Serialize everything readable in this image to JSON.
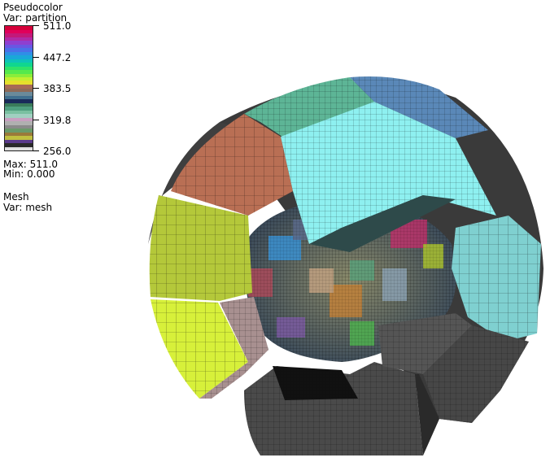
{
  "legend": {
    "pseudocolor_title": "Pseudocolor",
    "pseudocolor_var": "Var: partition",
    "ticks": [
      "511.0",
      "447.2",
      "383.5",
      "319.8",
      "256.0"
    ],
    "max_label": "Max:  511.0",
    "min_label": "Min:  0.000",
    "mesh_title": "Mesh",
    "mesh_var": "Var: mesh",
    "colorbar_stripes": [
      "#d6003a",
      "#e0005c",
      "#c2197a",
      "#b12aa6",
      "#8f3fd0",
      "#6a56e2",
      "#4a70e8",
      "#2f8fe6",
      "#1aa8d8",
      "#0ec3b8",
      "#10d690",
      "#2ee36a",
      "#55e94c",
      "#8aed3a",
      "#c2ef30",
      "#e6e02c",
      "#a86a55",
      "#8f6a58",
      "#6a8a9a",
      "#3f6f8f",
      "#1a2a5a",
      "#3a7a5a",
      "#4f9f7f",
      "#7ac0a0",
      "#a0d0c0",
      "#c8a0c0",
      "#b0b0b0",
      "#8a8a8a",
      "#6a9a6a",
      "#9a7a3a",
      "#c0c040",
      "#5a3a8a",
      "#2a2a2a",
      "#e0e0e0"
    ]
  },
  "scene": {
    "description_colors": {
      "teal_top": "#5db596",
      "salmon": "#b96f54",
      "cyan_big": "#8ef0f0",
      "yellow_green": "#b4c83a",
      "lime": "#d7f03a",
      "cyan_right": "#7fd0d0",
      "blue_top": "#5a88b8",
      "dark_gray": "#4a4a4a",
      "mauve": "#a89090"
    }
  }
}
